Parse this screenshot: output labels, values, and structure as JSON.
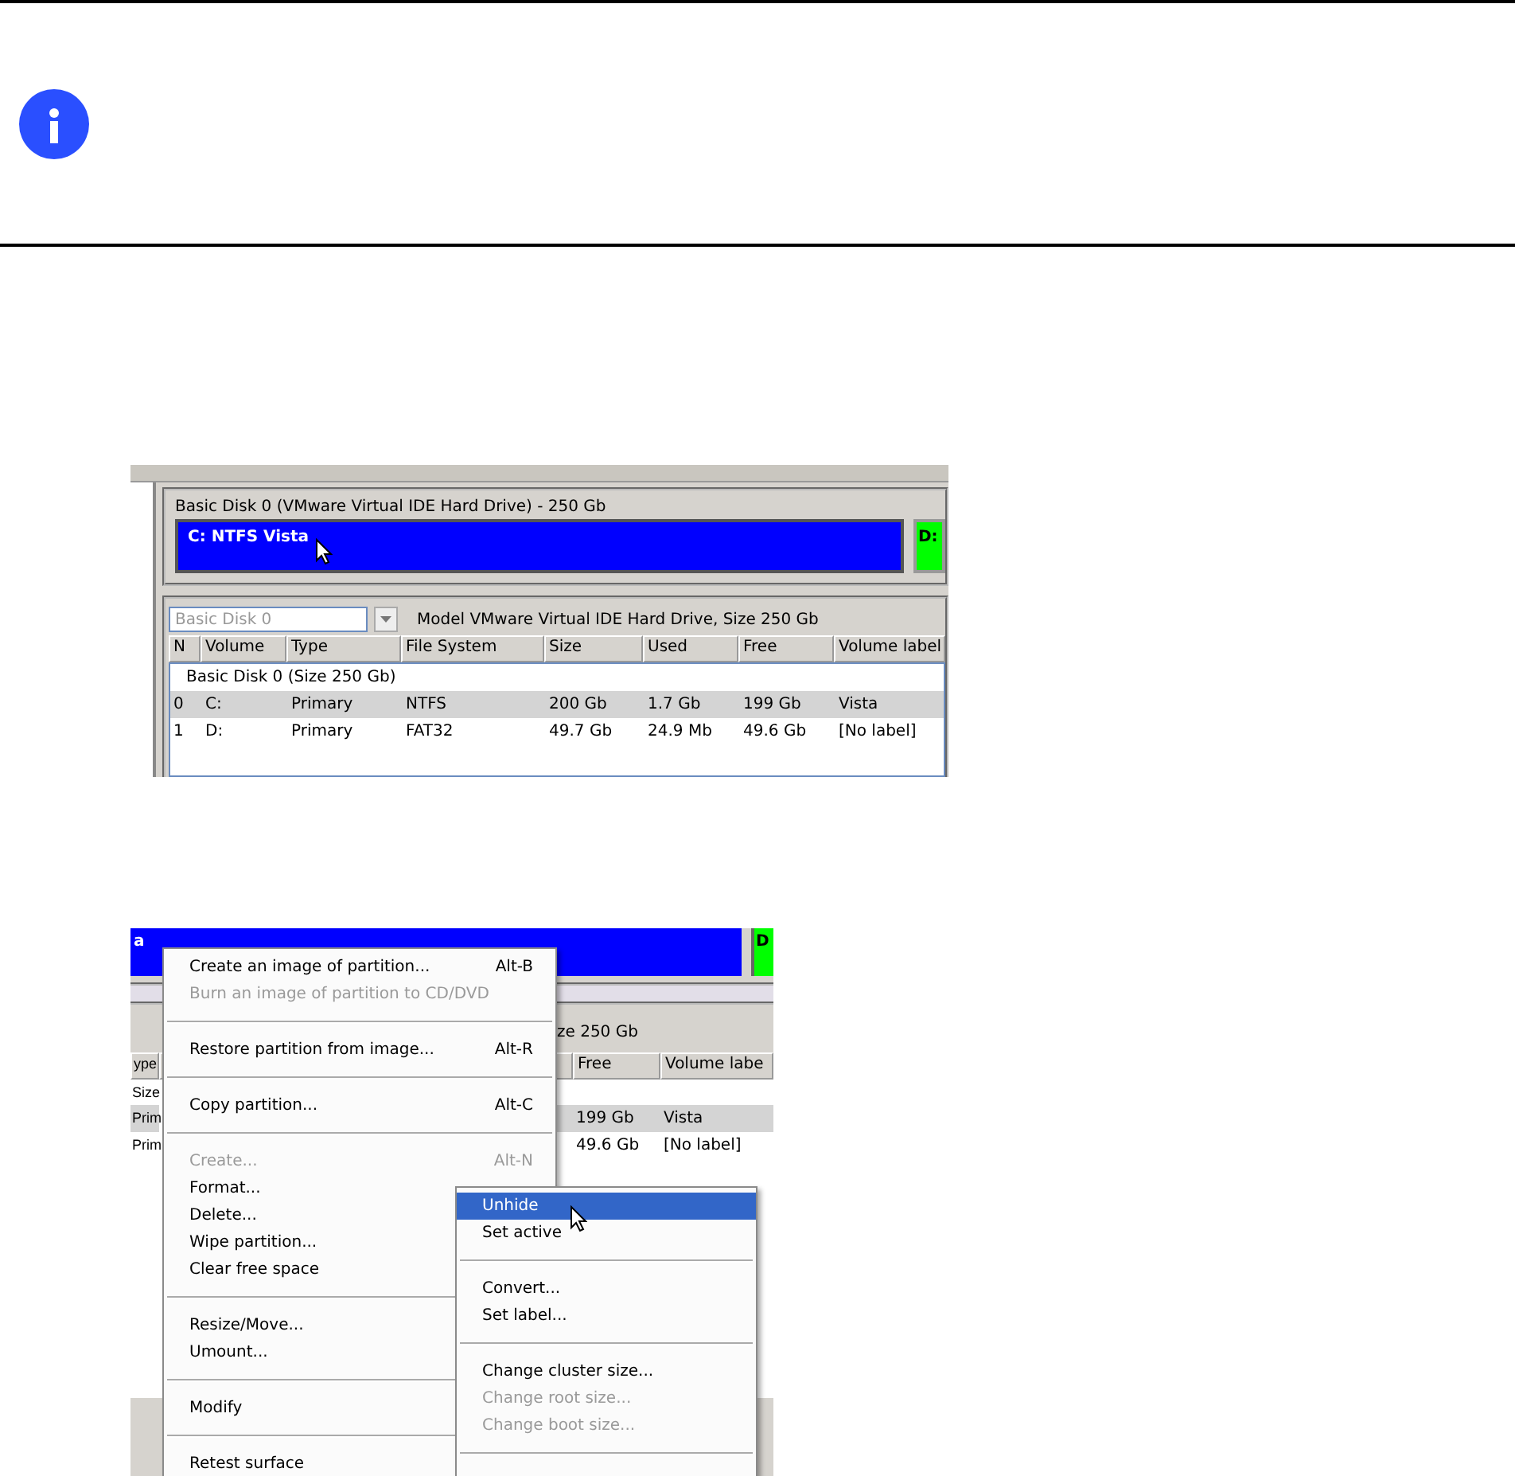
{
  "screenshot_1": {
    "disk_title": "Basic Disk 0 (VMware Virtual IDE Hard Drive) - 250 Gb",
    "partitions": [
      {
        "label": "C: NTFS Vista",
        "color": "#0000ff",
        "selected": true
      },
      {
        "label": "D:",
        "color": "#00ff00",
        "selected": false
      }
    ],
    "disk_combo": {
      "value": "Basic Disk 0"
    },
    "model_text": "Model VMware Virtual IDE Hard Drive, Size 250 Gb",
    "table": {
      "columns": [
        "N",
        "Volume",
        "Type",
        "File System",
        "Size",
        "Used",
        "Free",
        "Volume label"
      ],
      "group": "Basic Disk 0 (Size 250 Gb)",
      "rows": [
        {
          "cells": [
            "0",
            "C:",
            "Primary",
            "NTFS",
            "200 Gb",
            "1.7 Gb",
            "199 Gb",
            "Vista"
          ],
          "selected": true
        },
        {
          "cells": [
            "1",
            "D:",
            "Primary",
            "FAT32",
            "49.7 Gb",
            "24.9 Mb",
            "49.6 Gb",
            "[No label]"
          ],
          "selected": false
        }
      ]
    }
  },
  "screenshot_2": {
    "partition_fragments": [
      "a",
      "D"
    ],
    "model_fragment": "ze 250 Gb",
    "table": {
      "columns": [
        "ype",
        "Free",
        "Volume labe"
      ],
      "group": "Size",
      "rows": [
        {
          "cells": [
            "Prim",
            "199 Gb",
            "Vista"
          ],
          "selected": true
        },
        {
          "cells": [
            "Prim",
            "49.6 Gb",
            "[No label]"
          ],
          "selected": false
        }
      ]
    },
    "context_menu": [
      {
        "kind": "item",
        "label": "Create an image of partition...",
        "shortcut": "Alt-B",
        "disabled": false
      },
      {
        "kind": "item",
        "label": "Burn an image of partition to CD/DVD",
        "disabled": true
      },
      {
        "kind": "separator"
      },
      {
        "kind": "item",
        "label": "Restore partition from image...",
        "shortcut": "Alt-R",
        "disabled": false
      },
      {
        "kind": "separator"
      },
      {
        "kind": "item",
        "label": "Copy partition...",
        "shortcut": "Alt-C",
        "disabled": false
      },
      {
        "kind": "separator"
      },
      {
        "kind": "item",
        "label": "Create...",
        "shortcut": "Alt-N",
        "disabled": true
      },
      {
        "kind": "item",
        "label": "Format...",
        "disabled": false
      },
      {
        "kind": "item",
        "label": "Delete...",
        "disabled": false
      },
      {
        "kind": "item",
        "label": "Wipe partition...",
        "disabled": false
      },
      {
        "kind": "item",
        "label": "Clear free space",
        "disabled": false
      },
      {
        "kind": "separator"
      },
      {
        "kind": "item",
        "label": "Resize/Move...",
        "disabled": false
      },
      {
        "kind": "item",
        "label": "Umount...",
        "disabled": false
      },
      {
        "kind": "separator"
      },
      {
        "kind": "item",
        "label": "Modify",
        "disabled": false
      },
      {
        "kind": "separator"
      },
      {
        "kind": "item",
        "label": "Retest surface",
        "disabled": false
      }
    ],
    "submenu": [
      {
        "kind": "item",
        "label": "Unhide",
        "disabled": false,
        "selected": true
      },
      {
        "kind": "item",
        "label": "Set active",
        "disabled": false,
        "selected": false
      },
      {
        "kind": "separator"
      },
      {
        "kind": "item",
        "label": "Convert...",
        "disabled": false,
        "selected": false
      },
      {
        "kind": "item",
        "label": "Set label...",
        "disabled": false,
        "selected": false
      },
      {
        "kind": "separator"
      },
      {
        "kind": "item",
        "label": "Change cluster size...",
        "disabled": false,
        "selected": false
      },
      {
        "kind": "item",
        "label": "Change root size...",
        "disabled": true,
        "selected": false
      },
      {
        "kind": "item",
        "label": "Change boot size...",
        "disabled": true,
        "selected": false
      },
      {
        "kind": "separator"
      }
    ]
  }
}
